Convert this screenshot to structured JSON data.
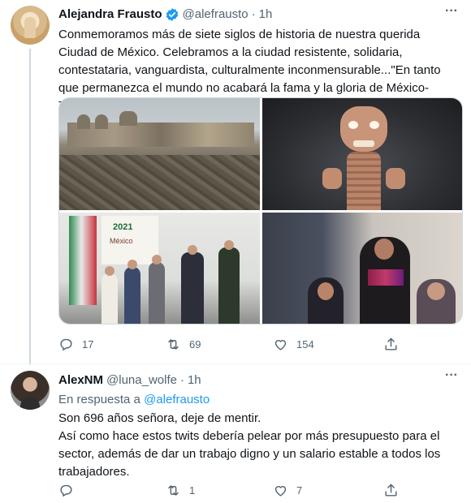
{
  "tweet1": {
    "author_name": "Alejandra Frausto",
    "handle": "@alefrausto",
    "separator": "·",
    "time": "1h",
    "text": "Conmemoramos más de siete siglos de historia de nuestra querida Ciudad de México. Celebramos a la ciudad resistente, solidaria, contestataria, vanguardista, culturalmente inconmensurable...\"En tanto que permanezca el mundo no acabará la fama y la gloria de México-Tenochtitlan.\"",
    "media_board_year": "2021",
    "media_board_text": "México",
    "stats": {
      "replies": "17",
      "retweets": "69",
      "likes": "154"
    }
  },
  "tweet2": {
    "author_name": "AlexNM",
    "handle": "@luna_wolfe",
    "separator": "·",
    "time": "1h",
    "reply_prefix": "En respuesta a",
    "reply_mention": "@alefrausto",
    "text_line1": "Son 696 años señora, deje de mentir.",
    "text_line2": "Así como hace estos twits debería pelear por más presupuesto para el sector, además de dar un trabajo digno y un salario estable a todos los trabajadores.",
    "stats": {
      "replies": "",
      "retweets": "1",
      "likes": "7"
    }
  },
  "icons": {
    "reply": "reply-icon",
    "retweet": "retweet-icon",
    "like": "heart-icon",
    "share": "share-icon",
    "more": "more-icon",
    "verified": "verified-badge-icon"
  },
  "colors": {
    "accent": "#1d9bf0",
    "text": "#0f1419",
    "secondary": "#536471",
    "border": "#cfd9de"
  }
}
